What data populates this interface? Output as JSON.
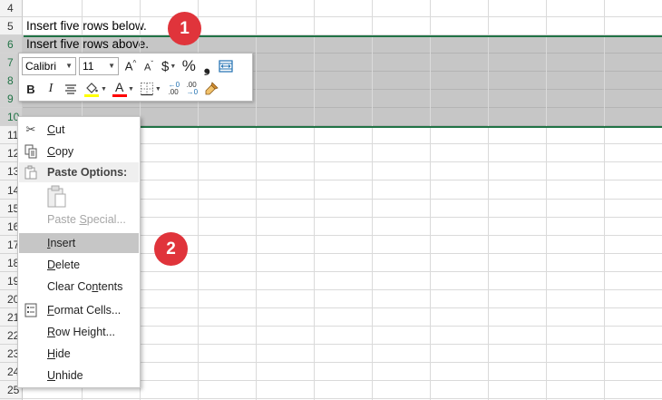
{
  "rows": [
    {
      "num": "4",
      "text": ""
    },
    {
      "num": "5",
      "text": "Insert five rows below."
    },
    {
      "num": "6",
      "text": "Insert five rows above."
    },
    {
      "num": "7",
      "text": ""
    },
    {
      "num": "8",
      "text": ""
    },
    {
      "num": "9",
      "text": ""
    },
    {
      "num": "10",
      "text": ""
    },
    {
      "num": "11",
      "text": ""
    },
    {
      "num": "12",
      "text": ""
    },
    {
      "num": "13",
      "text": ""
    },
    {
      "num": "14",
      "text": ""
    },
    {
      "num": "15",
      "text": ""
    },
    {
      "num": "16",
      "text": ""
    },
    {
      "num": "17",
      "text": ""
    },
    {
      "num": "18",
      "text": ""
    },
    {
      "num": "19",
      "text": ""
    },
    {
      "num": "20",
      "text": ""
    },
    {
      "num": "21",
      "text": ""
    },
    {
      "num": "22",
      "text": ""
    },
    {
      "num": "23",
      "text": ""
    },
    {
      "num": "24",
      "text": ""
    },
    {
      "num": "25",
      "text": ""
    }
  ],
  "minibar": {
    "font": "Calibri",
    "size": "11",
    "grow_font": "A^",
    "shrink_font": "Aˇ",
    "currency": "$",
    "percent": "%",
    "comma": "❟",
    "bold": "B",
    "italic": "I",
    "font_color_letter": "A",
    "increase_decimal_top": "←0",
    "increase_decimal_bottom": ".00",
    "decrease_decimal_top": ".00",
    "decrease_decimal_bottom": "→0"
  },
  "context_menu": {
    "cut": "Cut",
    "copy": "Copy",
    "paste_options": "Paste Options:",
    "paste_special": "Paste Special...",
    "insert": "Insert",
    "delete": "Delete",
    "clear_contents": "Clear Contents",
    "format_cells": "Format Cells...",
    "row_height": "Row Height...",
    "hide": "Hide",
    "unhide": "Unhide"
  },
  "badges": {
    "step1": "1",
    "step2": "2"
  },
  "colors": {
    "selection": "#c6c6c6",
    "accent": "#217346",
    "badge": "#e0343b",
    "highlight_yellow": "#ffff00",
    "font_red": "#ff0000"
  }
}
